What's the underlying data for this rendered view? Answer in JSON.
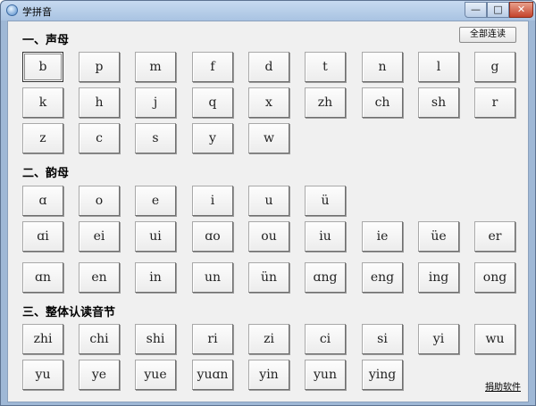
{
  "window": {
    "title": "学拼音",
    "minimize_label": "—",
    "maximize_label": "□",
    "close_label": "✕"
  },
  "toolbar": {
    "read_all_label": "全部连读",
    "donate_label": "捐助软件"
  },
  "sections": [
    {
      "title": "一、声母",
      "rows": [
        [
          "b",
          "p",
          "m",
          "f",
          "d",
          "t",
          "n",
          "l",
          "g"
        ],
        [
          "k",
          "h",
          "j",
          "q",
          "x",
          "zh",
          "ch",
          "sh",
          "r"
        ],
        [
          "z",
          "c",
          "s",
          "y",
          "w"
        ]
      ]
    },
    {
      "title": "二、韵母",
      "rows": [
        [
          "ɑ",
          "o",
          "e",
          "i",
          "u",
          "ü"
        ],
        [
          "ɑi",
          "ei",
          "ui",
          "ɑo",
          "ou",
          "iu",
          "ie",
          "üe",
          "er"
        ],
        [
          "ɑn",
          "en",
          "in",
          "un",
          "ün",
          "ɑng",
          "eng",
          "ing",
          "ong"
        ]
      ]
    },
    {
      "title": "三、整体认读音节",
      "rows": [
        [
          "zhi",
          "chi",
          "shi",
          "ri",
          "zi",
          "ci",
          "si",
          "yi",
          "wu"
        ],
        [
          "yu",
          "ye",
          "yue",
          "yuɑn",
          "yin",
          "yun",
          "ying"
        ]
      ]
    }
  ],
  "selected_key": "b"
}
